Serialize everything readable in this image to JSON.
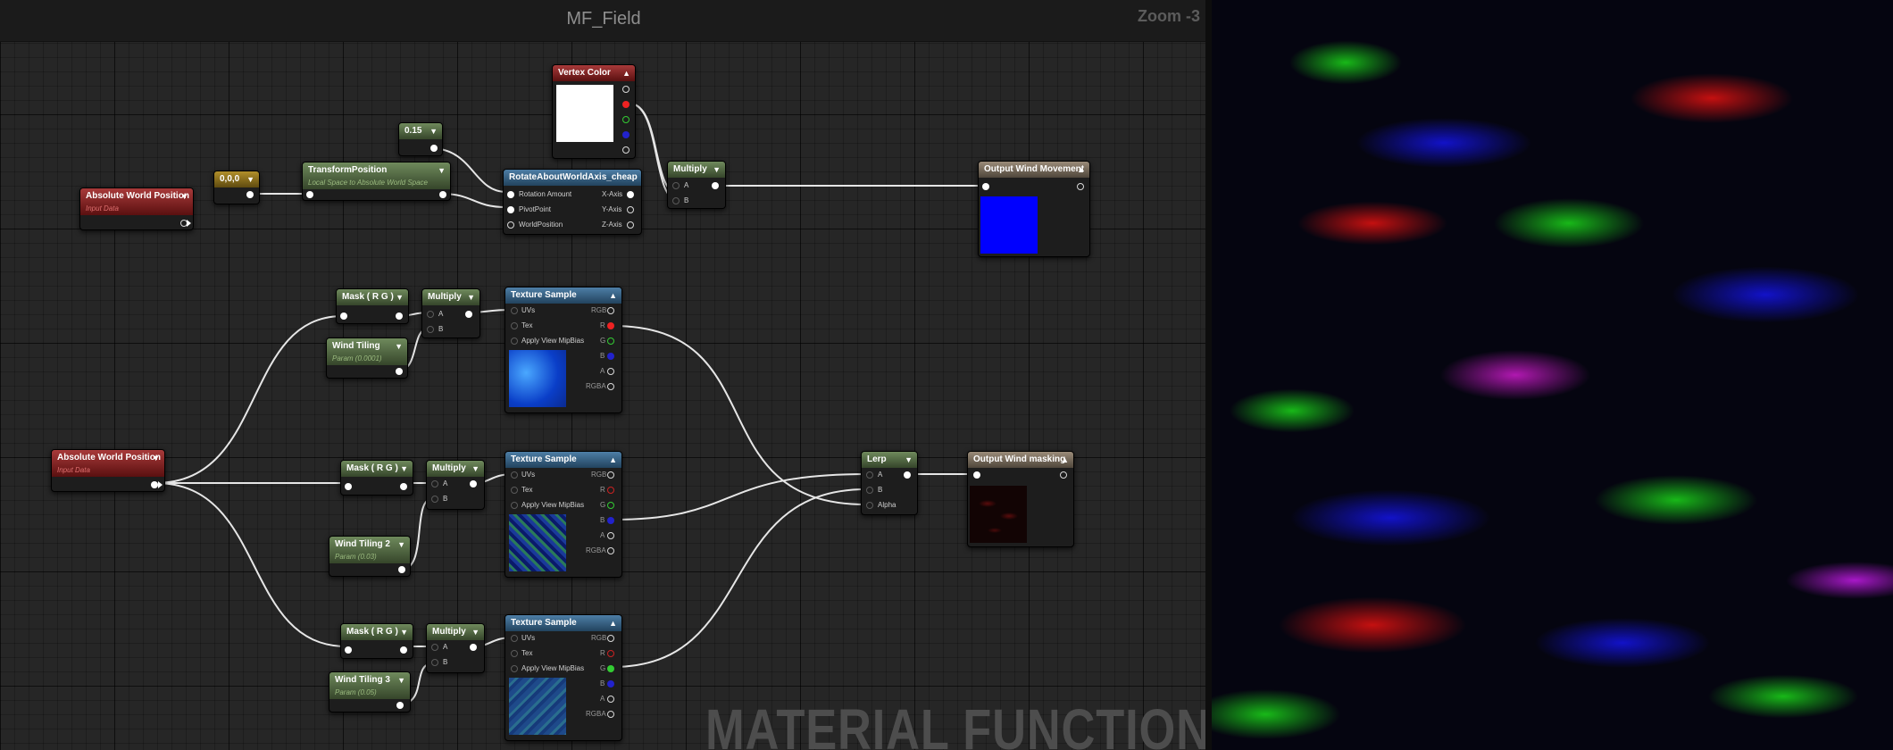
{
  "graph": {
    "title": "MF_Field",
    "zoom": "Zoom -3",
    "watermark": "MATERIAL FUNCTION"
  },
  "colors": {
    "input_header": "#8a1f1f",
    "param_header": "#4e6a3c",
    "constant_header": "#8c701a",
    "function_header": "#2f5f85",
    "output_header": "#7c6e5c",
    "output_preview_blue": "#0000ff"
  },
  "nodes": {
    "abs_world_pos_1": {
      "title": "Absolute World Position",
      "subtitle": "Input Data"
    },
    "const_000": {
      "title": "0,0,0"
    },
    "transform_position": {
      "title": "TransformPosition",
      "subtitle": "Local Space to Absolute World Space"
    },
    "const_015": {
      "title": "0.15"
    },
    "vertex_color": {
      "title": "Vertex Color"
    },
    "rotate_about_axis": {
      "title": "RotateAboutWorldAxis_cheap",
      "inputs": [
        "Rotation Amount",
        "PivotPoint",
        "WorldPosition"
      ],
      "outputs": [
        "X-Axis",
        "Y-Axis",
        "Z-Axis"
      ]
    },
    "multiply_top": {
      "title": "Multiply",
      "inputs": [
        "A",
        "B"
      ]
    },
    "output_wind_movement": {
      "title": "Output Wind Movement"
    },
    "abs_world_pos_2": {
      "title": "Absolute World Position",
      "subtitle": "Input Data"
    },
    "mask_1": {
      "title": "Mask ( R G )"
    },
    "multiply_1": {
      "title": "Multiply",
      "inputs": [
        "A",
        "B"
      ]
    },
    "wind_tiling_1": {
      "title": "Wind Tiling",
      "subtitle": "Param (0.0001)"
    },
    "tex_sample_1": {
      "title": "Texture Sample",
      "inputs": [
        "UVs",
        "Tex",
        "Apply View MipBias"
      ],
      "outputs": [
        "RGB",
        "R",
        "G",
        "B",
        "A",
        "RGBA"
      ]
    },
    "mask_2": {
      "title": "Mask ( R G )"
    },
    "multiply_2": {
      "title": "Multiply",
      "inputs": [
        "A",
        "B"
      ]
    },
    "wind_tiling_2": {
      "title": "Wind Tiling 2",
      "subtitle": "Param (0.03)"
    },
    "tex_sample_2": {
      "title": "Texture Sample",
      "inputs": [
        "UVs",
        "Tex",
        "Apply View MipBias"
      ],
      "outputs": [
        "RGB",
        "R",
        "G",
        "B",
        "A",
        "RGBA"
      ]
    },
    "mask_3": {
      "title": "Mask ( R G )"
    },
    "multiply_3": {
      "title": "Multiply",
      "inputs": [
        "A",
        "B"
      ]
    },
    "wind_tiling_3": {
      "title": "Wind Tiling 3",
      "subtitle": "Param (0.05)"
    },
    "tex_sample_3": {
      "title": "Texture Sample",
      "inputs": [
        "UVs",
        "Tex",
        "Apply View MipBias"
      ],
      "outputs": [
        "RGB",
        "R",
        "G",
        "B",
        "A",
        "RGBA"
      ]
    },
    "lerp": {
      "title": "Lerp",
      "inputs": [
        "A",
        "B",
        "Alpha"
      ]
    },
    "output_wind_masking": {
      "title": "Output Wind masking"
    }
  }
}
